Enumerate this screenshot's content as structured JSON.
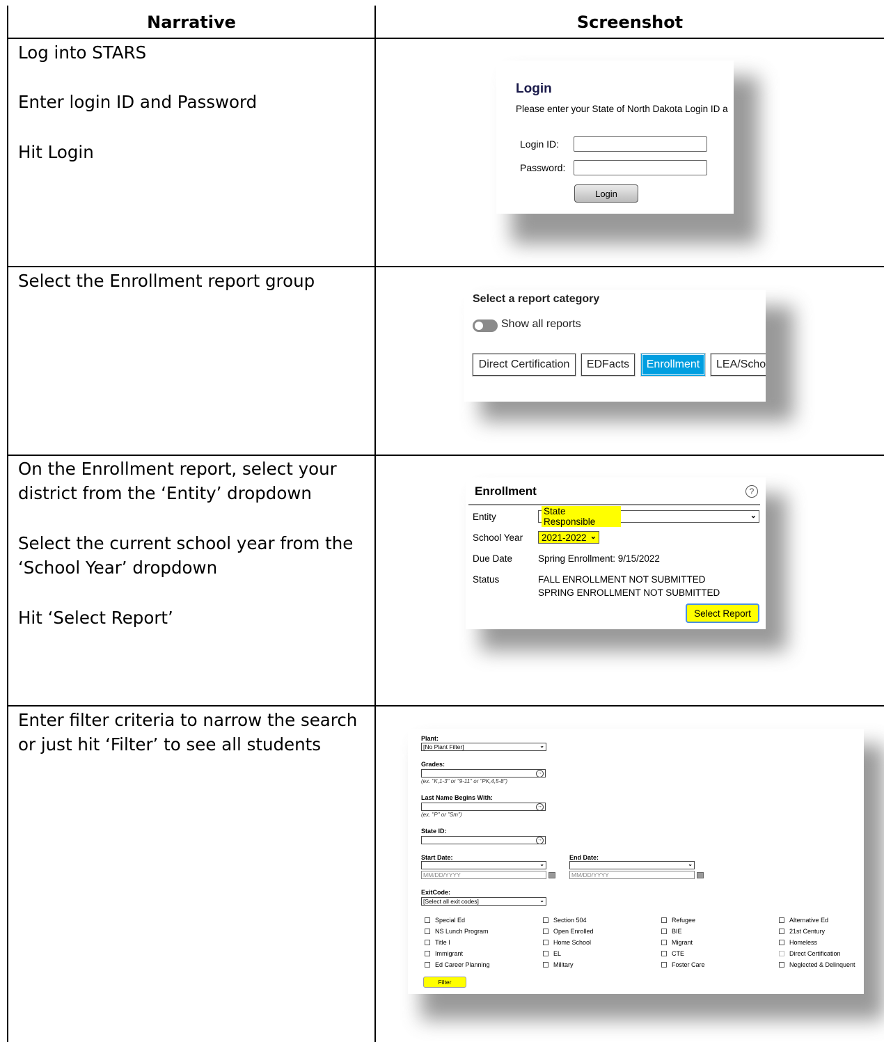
{
  "table": {
    "headers": {
      "narrative": "Narrative",
      "screenshot": "Screenshot"
    },
    "rows": [
      {
        "lines": [
          "Log into STARS",
          "Enter login ID and Password",
          "Hit Login"
        ]
      },
      {
        "lines": [
          "Select the Enrollment report group"
        ]
      },
      {
        "lines": [
          "On the Enrollment report, select your district from the ‘Entity’ dropdown",
          "Select the current school year from the ‘School Year’ dropdown",
          "Hit ‘Select Report’"
        ]
      },
      {
        "lines": [
          "Enter filter criteria to narrow the search or just hit ‘Filter’ to see all students"
        ]
      }
    ]
  },
  "login": {
    "title": "Login",
    "subtitle": "Please enter your State of North Dakota Login ID a",
    "login_id_label": "Login ID:",
    "password_label": "Password:",
    "button": "Login"
  },
  "category": {
    "title": "Select a report category",
    "toggle_label": "Show all reports",
    "buttons": [
      "Direct Certification",
      "EDFacts",
      "Enrollment",
      "LEA/Scho"
    ],
    "active": "Enrollment"
  },
  "enrollment": {
    "title": "Enrollment",
    "help": "?",
    "entity_label": "Entity",
    "entity_value": "State Responsible",
    "year_label": "School Year",
    "year_value": "2021-2022",
    "due_label": "Due Date",
    "due_value": "Spring Enrollment: 9/15/2022",
    "status_label": "Status",
    "status_line1": "FALL ENROLLMENT NOT SUBMITTED",
    "status_line2": "SPRING ENROLLMENT NOT SUBMITTED",
    "button": "Select Report"
  },
  "filter": {
    "plant_label": "Plant:",
    "plant_value": "[No Plant Filter]",
    "grades_label": "Grades:",
    "grades_hint": "(ex. \"K,1-3\" or \"9-11\" or \"PK,4,5-8\")",
    "lastname_label": "Last Name Begins With:",
    "lastname_hint": "(ex. \"P\" or \"Sm\")",
    "stateid_label": "State ID:",
    "start_label": "Start Date:",
    "end_label": "End Date:",
    "date_placeholder": "MM/DD/YYYY",
    "exit_label": "ExitCode:",
    "exit_value": "[Select all exit codes]",
    "checkbox_cols": [
      [
        "Special Ed",
        "NS Lunch Program",
        "Title I",
        "Immigrant",
        "Ed Career Planning"
      ],
      [
        "Section 504",
        "Open Enrolled",
        "Home School",
        "EL",
        "Military"
      ],
      [
        "Refugee",
        "BIE",
        "Migrant",
        "CTE",
        "Foster Care"
      ],
      [
        "Alternative Ed",
        "21st Century",
        "Homeless",
        "Direct Certification",
        "Neglected & Delinquent"
      ]
    ],
    "button": "Filter"
  }
}
